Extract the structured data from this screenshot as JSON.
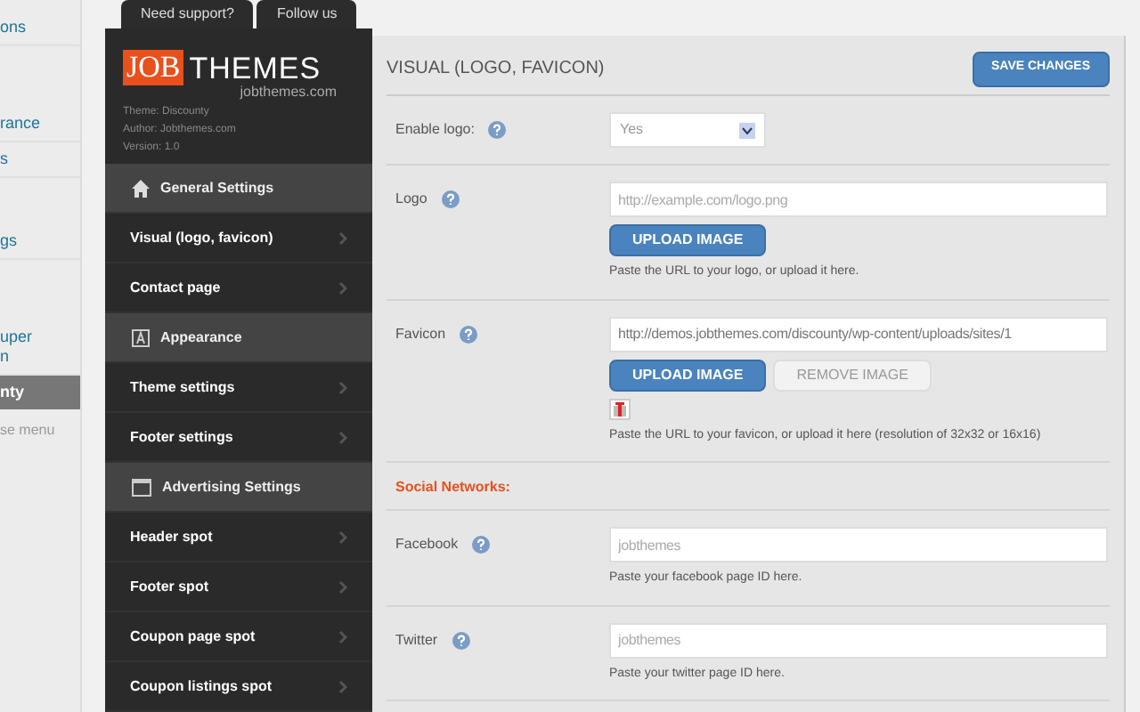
{
  "wp_menu": [
    {
      "label": "ons",
      "selected": false
    },
    {
      "label": "rance",
      "selected": false
    },
    {
      "label": "s",
      "selected": false
    },
    {
      "label": "gs",
      "selected": false
    },
    {
      "label": "uper\nn",
      "selected": false
    },
    {
      "label": "nty",
      "selected": true
    }
  ],
  "wp_collapse": "se menu",
  "top_tabs": [
    "Need support?",
    "Follow us"
  ],
  "brand": {
    "logo_box": "JOB",
    "logo_rest": "THEMES",
    "site": "jobthemes.com",
    "meta": [
      "Theme: Discounty",
      "Author: Jobthemes.com",
      "Version: 1.0"
    ]
  },
  "nav": [
    {
      "kind": "header",
      "label": "General Settings"
    },
    {
      "kind": "item",
      "label": "Visual (logo, favicon)"
    },
    {
      "kind": "item",
      "label": "Contact page"
    },
    {
      "kind": "header",
      "label": "Appearance"
    },
    {
      "kind": "item",
      "label": "Theme settings"
    },
    {
      "kind": "item",
      "label": "Footer settings"
    },
    {
      "kind": "header",
      "label": "Advertising Settings"
    },
    {
      "kind": "item",
      "label": "Header spot"
    },
    {
      "kind": "item",
      "label": "Footer spot"
    },
    {
      "kind": "item",
      "label": "Coupon page spot"
    },
    {
      "kind": "item",
      "label": "Coupon listings spot"
    }
  ],
  "page_title": "VISUAL (LOGO, FAVICON)",
  "save_button": "SAVE CHANGES",
  "sections": [
    {
      "kind": "select",
      "label": "Enable logo:",
      "value": "Yes"
    },
    {
      "kind": "input",
      "label": "Logo",
      "placeholder": "http://example.com/logo.png",
      "buttons": [
        "UPLOAD IMAGE"
      ],
      "hint": "Paste the URL to your logo, or upload it here."
    },
    {
      "kind": "input",
      "label": "Favicon",
      "value": "http://demos.jobthemes.com/discounty/wp-content/uploads/sites/1",
      "buttons": [
        "UPLOAD IMAGE",
        "REMOVE IMAGE"
      ],
      "preview": true,
      "hint": "Paste the URL to your favicon, or upload it here (resolution of 32x32 or 16x16)"
    },
    {
      "kind": "heading",
      "label": "Social Networks:"
    },
    {
      "kind": "input",
      "label": "Facebook",
      "placeholder": "jobthemes",
      "hint": "Paste your facebook page ID here."
    },
    {
      "kind": "input",
      "label": "Twitter",
      "placeholder": "jobthemes",
      "hint": "Paste your twitter page ID here."
    }
  ]
}
